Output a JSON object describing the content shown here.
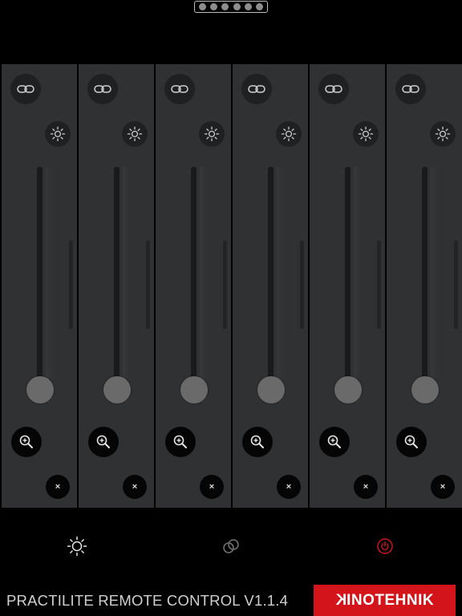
{
  "pager": {
    "pages": 6,
    "current": 1
  },
  "channels": [
    {
      "id": 1,
      "level": 0.04
    },
    {
      "id": 2,
      "level": 0.04
    },
    {
      "id": 3,
      "level": 0.04
    },
    {
      "id": 4,
      "level": 0.04
    },
    {
      "id": 5,
      "level": 0.04
    },
    {
      "id": 6,
      "level": 0.04
    }
  ],
  "channel_labels": {
    "close": "×"
  },
  "icons": {
    "link": "link-icon",
    "brightness": "brightness-icon",
    "zoom": "zoom-in-icon",
    "close": "close-icon",
    "toolbar_brightness": "sun-icon",
    "toolbar_link": "link-rings-icon",
    "toolbar_power": "power-icon"
  },
  "colors": {
    "accent_red": "#d3151b",
    "power_icon": "#d3151b"
  },
  "footer": {
    "title": "PRACTILITE REMOTE CONTROL V1.1.4",
    "brand_first_letter": "K",
    "brand_rest": "INOTEHNIK"
  }
}
